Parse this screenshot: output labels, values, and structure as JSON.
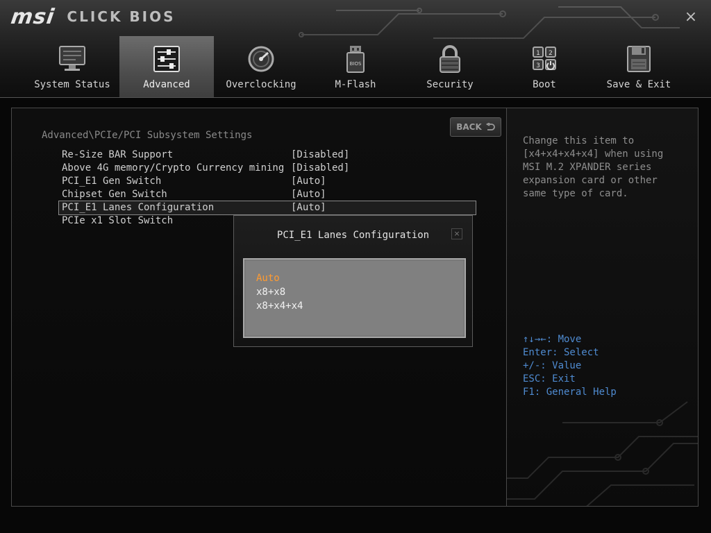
{
  "brand": {
    "logo": "msi",
    "product": "CLICK BIOS"
  },
  "close_label": "×",
  "tabs": [
    {
      "label": "System Status",
      "icon": "monitor-icon"
    },
    {
      "label": "Advanced",
      "icon": "sliders-icon",
      "active": true
    },
    {
      "label": "Overclocking",
      "icon": "gauge-icon"
    },
    {
      "label": "M-Flash",
      "icon": "usb-drive-icon"
    },
    {
      "label": "Security",
      "icon": "padlock-icon"
    },
    {
      "label": "Boot",
      "icon": "boot-order-icon"
    },
    {
      "label": "Save & Exit",
      "icon": "floppy-disk-icon"
    }
  ],
  "main": {
    "breadcrumb": "Advanced\\PCIe/PCI Subsystem Settings",
    "back_label": "BACK",
    "settings": [
      {
        "name": "Re-Size BAR Support",
        "value": "[Disabled]"
      },
      {
        "name": "Above 4G memory/Crypto Currency mining",
        "value": "[Disabled]"
      },
      {
        "name": "PCI_E1 Gen Switch",
        "value": "[Auto]"
      },
      {
        "name": "Chipset Gen Switch",
        "value": "[Auto]"
      },
      {
        "name": "PCI_E1 Lanes Configuration",
        "value": "[Auto]",
        "selected": true
      },
      {
        "name": "PCIe x1 Slot Switch",
        "value": ""
      }
    ]
  },
  "popup": {
    "title": "PCI_E1 Lanes Configuration",
    "close_label": "×",
    "options": [
      "Auto",
      "x8+x8",
      "x8+x4+x4"
    ],
    "current_option": "Auto"
  },
  "help": {
    "description": "Change this item to\n[x4+x4+x4+x4] when using\nMSI M.2 XPANDER series\nexpansion card or other\nsame type of card.",
    "keys": [
      "↑↓→←: Move",
      "Enter: Select",
      "+/-: Value",
      "ESC: Exit",
      "F1: General Help"
    ]
  },
  "colors": {
    "accent_option": "#ff9a30",
    "key_help": "#4f8bd1"
  }
}
